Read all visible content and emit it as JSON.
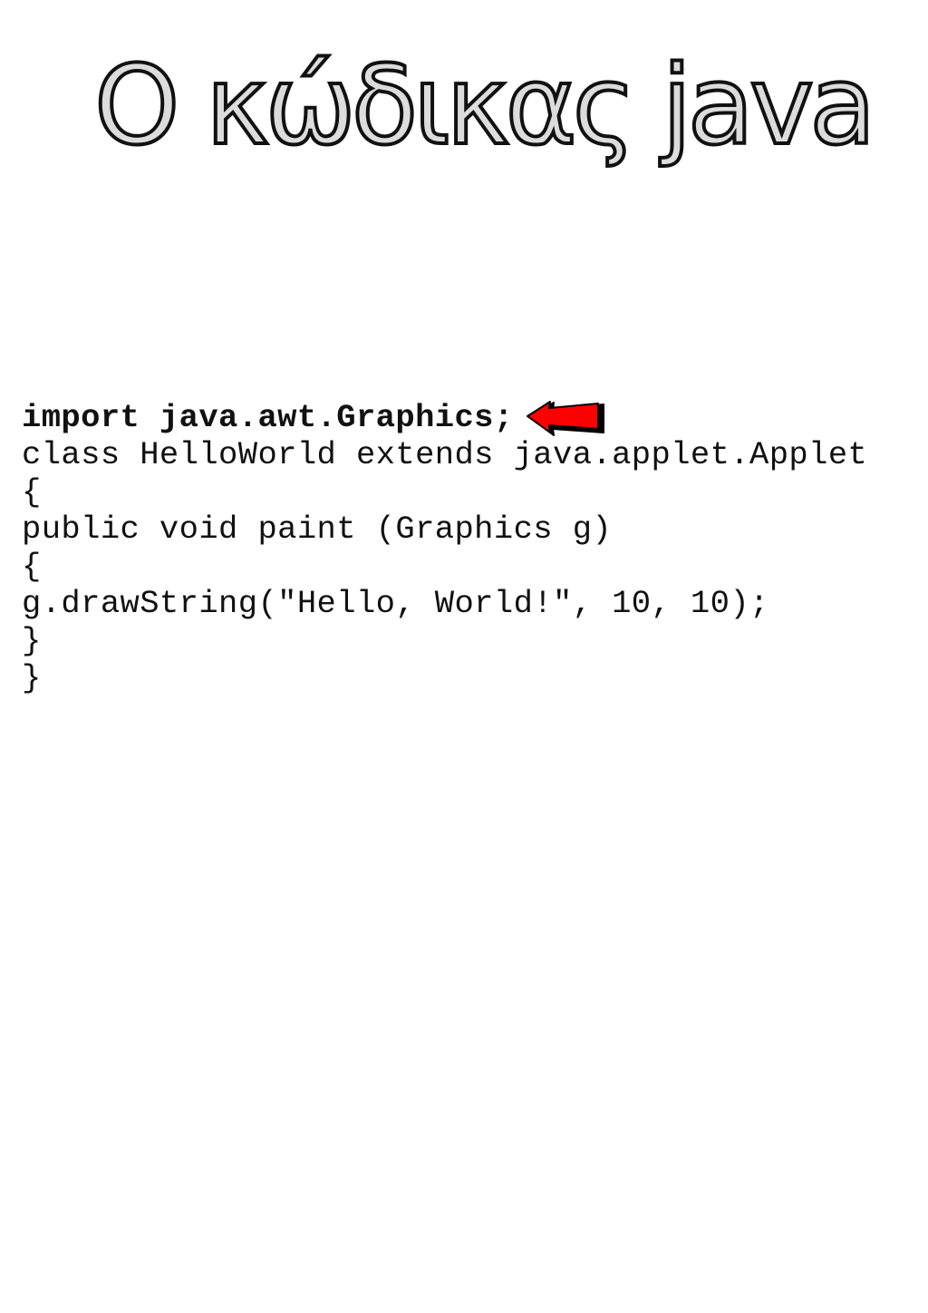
{
  "title": "Ο κώδικας java",
  "code": {
    "lines": [
      "import java.awt.Graphics;",
      "class HelloWorld extends java.applet.Applet",
      "{",
      "public void paint (Graphics g)",
      "{",
      "g.drawString(\"Hello, World!\", 10, 10);",
      "}",
      "}"
    ]
  },
  "pointer": {
    "icon": "left-arrow-icon",
    "color": "#ff0000",
    "shadow_color": "#000000"
  }
}
